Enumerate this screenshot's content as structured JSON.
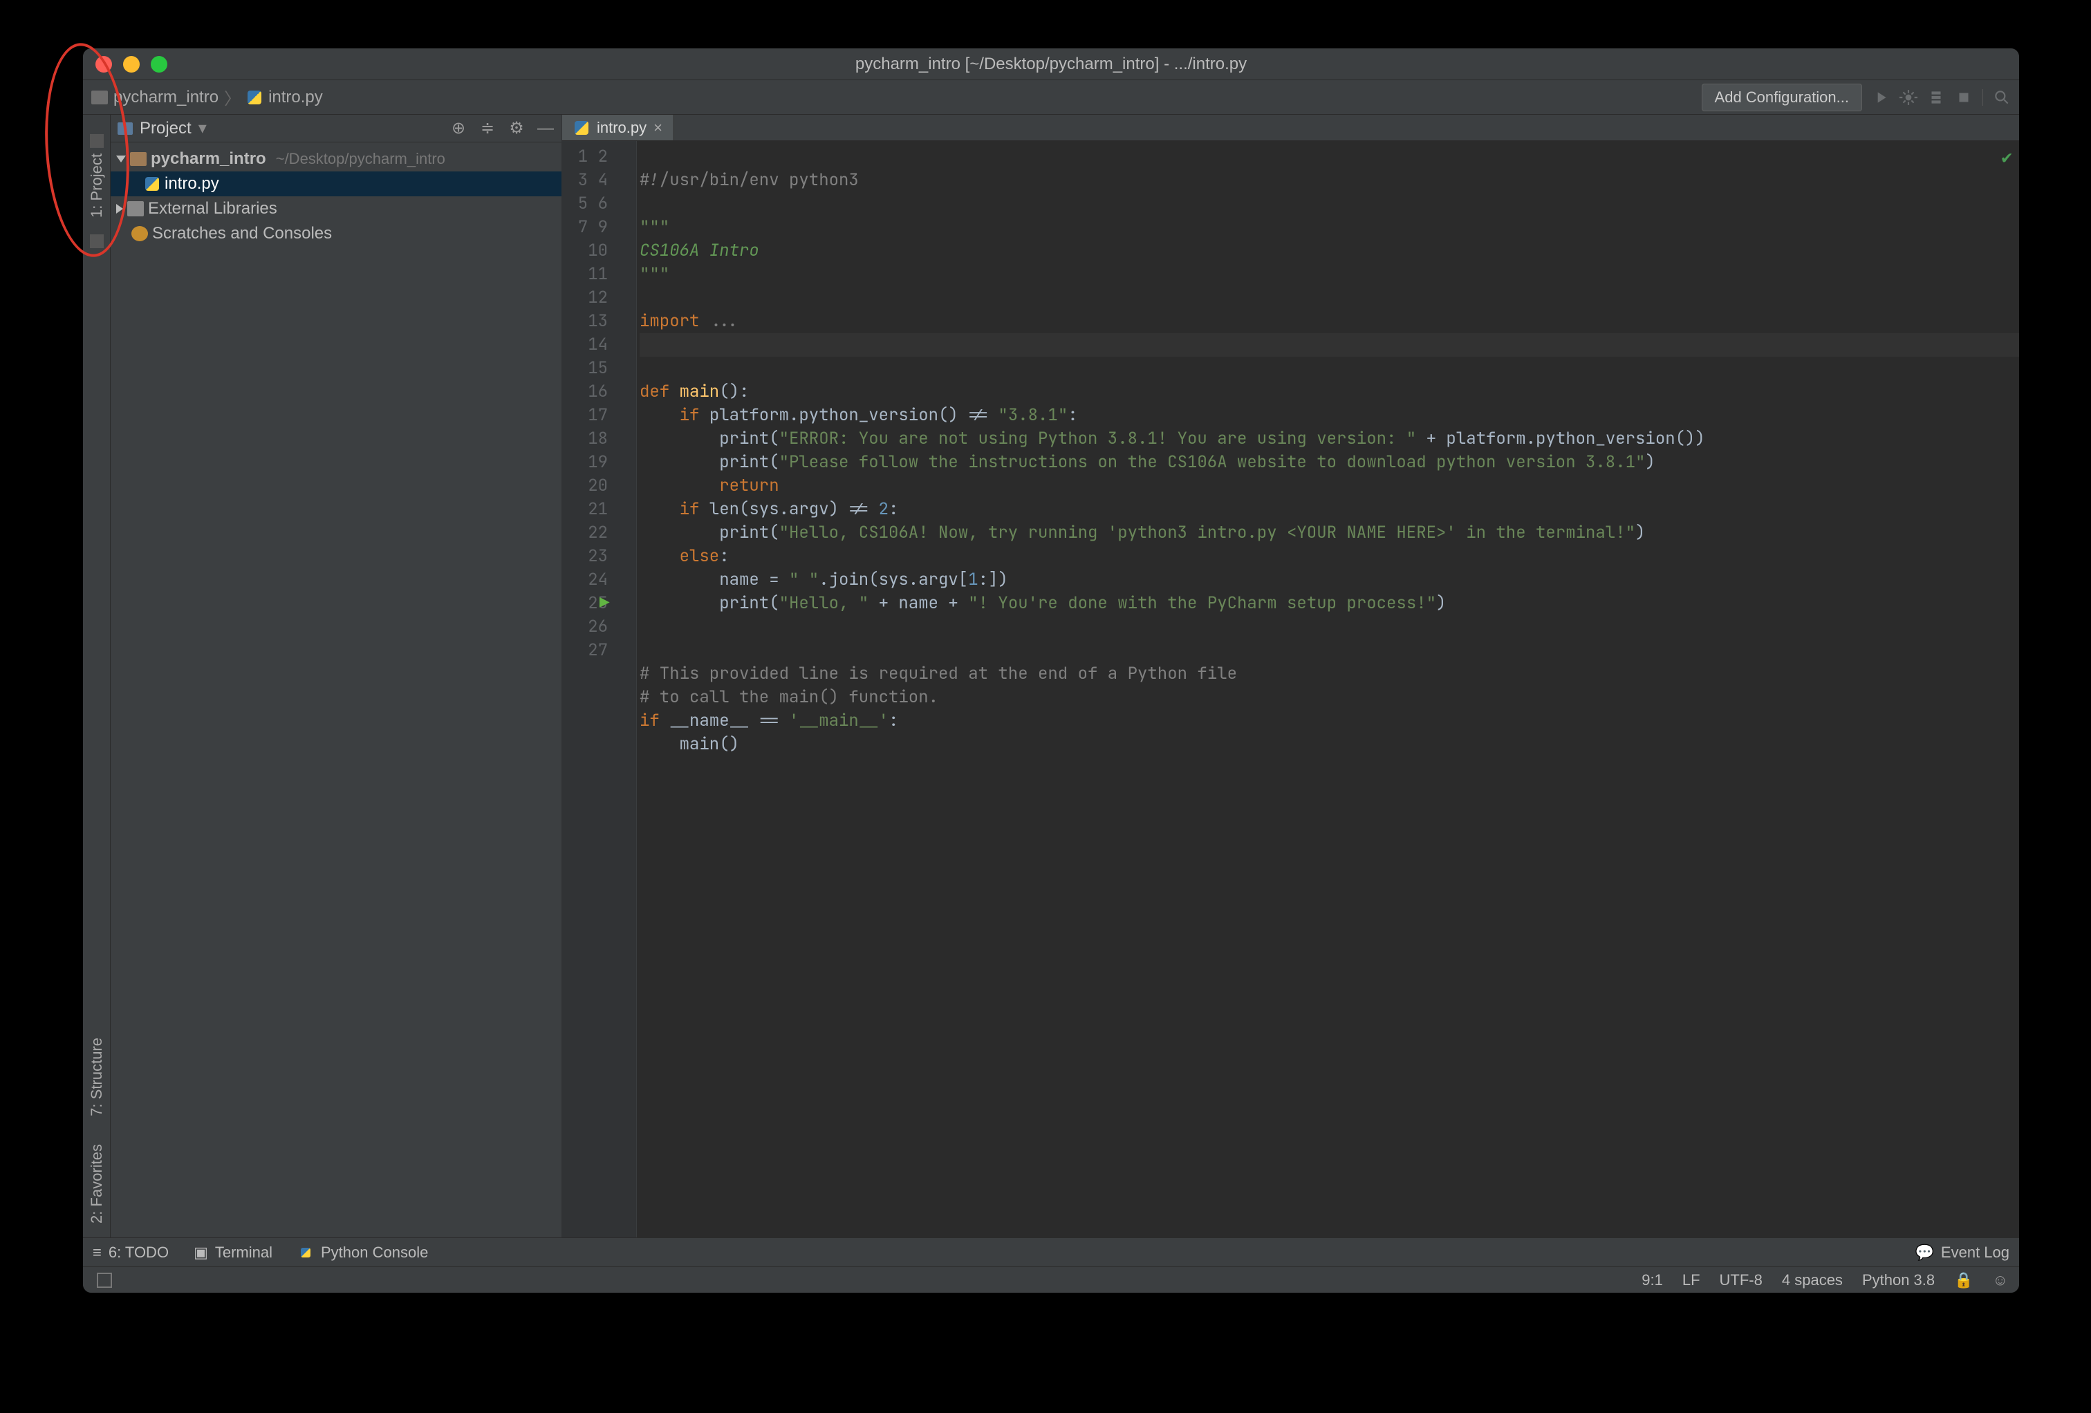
{
  "window": {
    "title": "pycharm_intro [~/Desktop/pycharm_intro] - .../intro.py"
  },
  "breadcrumb": {
    "project": "pycharm_intro",
    "file": "intro.py"
  },
  "toolbar": {
    "add_config": "Add Configuration..."
  },
  "leftrail": {
    "project": "1: Project",
    "structure": "7: Structure",
    "favorites": "2: Favorites"
  },
  "project_panel": {
    "title": "Project",
    "root": "pycharm_intro",
    "root_path": "~/Desktop/pycharm_intro",
    "file1": "intro.py",
    "ext_lib": "External Libraries",
    "scratches": "Scratches and Consoles"
  },
  "tabs": {
    "file": "intro.py"
  },
  "gutter": {
    "lines": [
      "1",
      "2",
      "3",
      "4",
      "5",
      "6",
      "7",
      "9",
      "10",
      "11",
      "12",
      "13",
      "14",
      "15",
      "16",
      "17",
      "18",
      "19",
      "20",
      "21",
      "22",
      "23",
      "24",
      "25",
      "26",
      "27"
    ]
  },
  "code": {
    "l1_shebang": "#!/usr/bin/env python3",
    "l3_tq": "\"\"\"",
    "l4_doc": "CS106A Intro",
    "l5_tq": "\"\"\"",
    "l7_import": "import",
    "l7_ell": " ...",
    "l11_def": "def ",
    "l11_fn": "main",
    "l11_paren": "():",
    "l12_if": "    if ",
    "l12_cond": "platform.python_version() != ",
    "l12_str": "\"3.8.1\"",
    "l12_colon": ":",
    "l13_pre": "        print(",
    "l13_str": "\"ERROR: You are not using Python 3.8.1! You are using version: \"",
    "l13_plus": " + platform.python_version())",
    "l14_pre": "        print(",
    "l14_str": "\"Please follow the instructions on the CS106A website to download python version 3.8.1\"",
    "l14_close": ")",
    "l15_ret": "        return",
    "l16_if": "    if ",
    "l16_cond": "len(sys.argv) != ",
    "l16_num": "2",
    "l16_colon": ":",
    "l17_pre": "        print(",
    "l17_str": "\"Hello, CS106A! Now, try running 'python3 intro.py <YOUR NAME HERE>' in the terminal!\"",
    "l17_close": ")",
    "l18_else": "    else",
    "l18_colon": ":",
    "l19_body": "        name = ",
    "l19_str": "\" \"",
    "l19_rest": ".join(sys.argv[",
    "l19_num": "1",
    "l19_rest2": ":])",
    "l20_pre": "        print(",
    "l20_s1": "\"Hello, \"",
    "l20_mid": " + name + ",
    "l20_s2": "\"! You're done with the PyCharm setup process!\"",
    "l20_close": ")",
    "l23_c": "# This provided line is required at the end of a Python file",
    "l24_c": "# to call the main() function.",
    "l25_if": "if ",
    "l25_name": "__name__ == ",
    "l25_str": "'__main__'",
    "l25_colon": ":",
    "l26_main": "    main()"
  },
  "bottombar": {
    "todo": "6: TODO",
    "terminal": "Terminal",
    "pyconsole": "Python Console",
    "eventlog": "Event Log"
  },
  "status": {
    "pos": "9:1",
    "sep": "LF",
    "enc": "UTF-8",
    "indent": "4 spaces",
    "interp": "Python 3.8"
  }
}
